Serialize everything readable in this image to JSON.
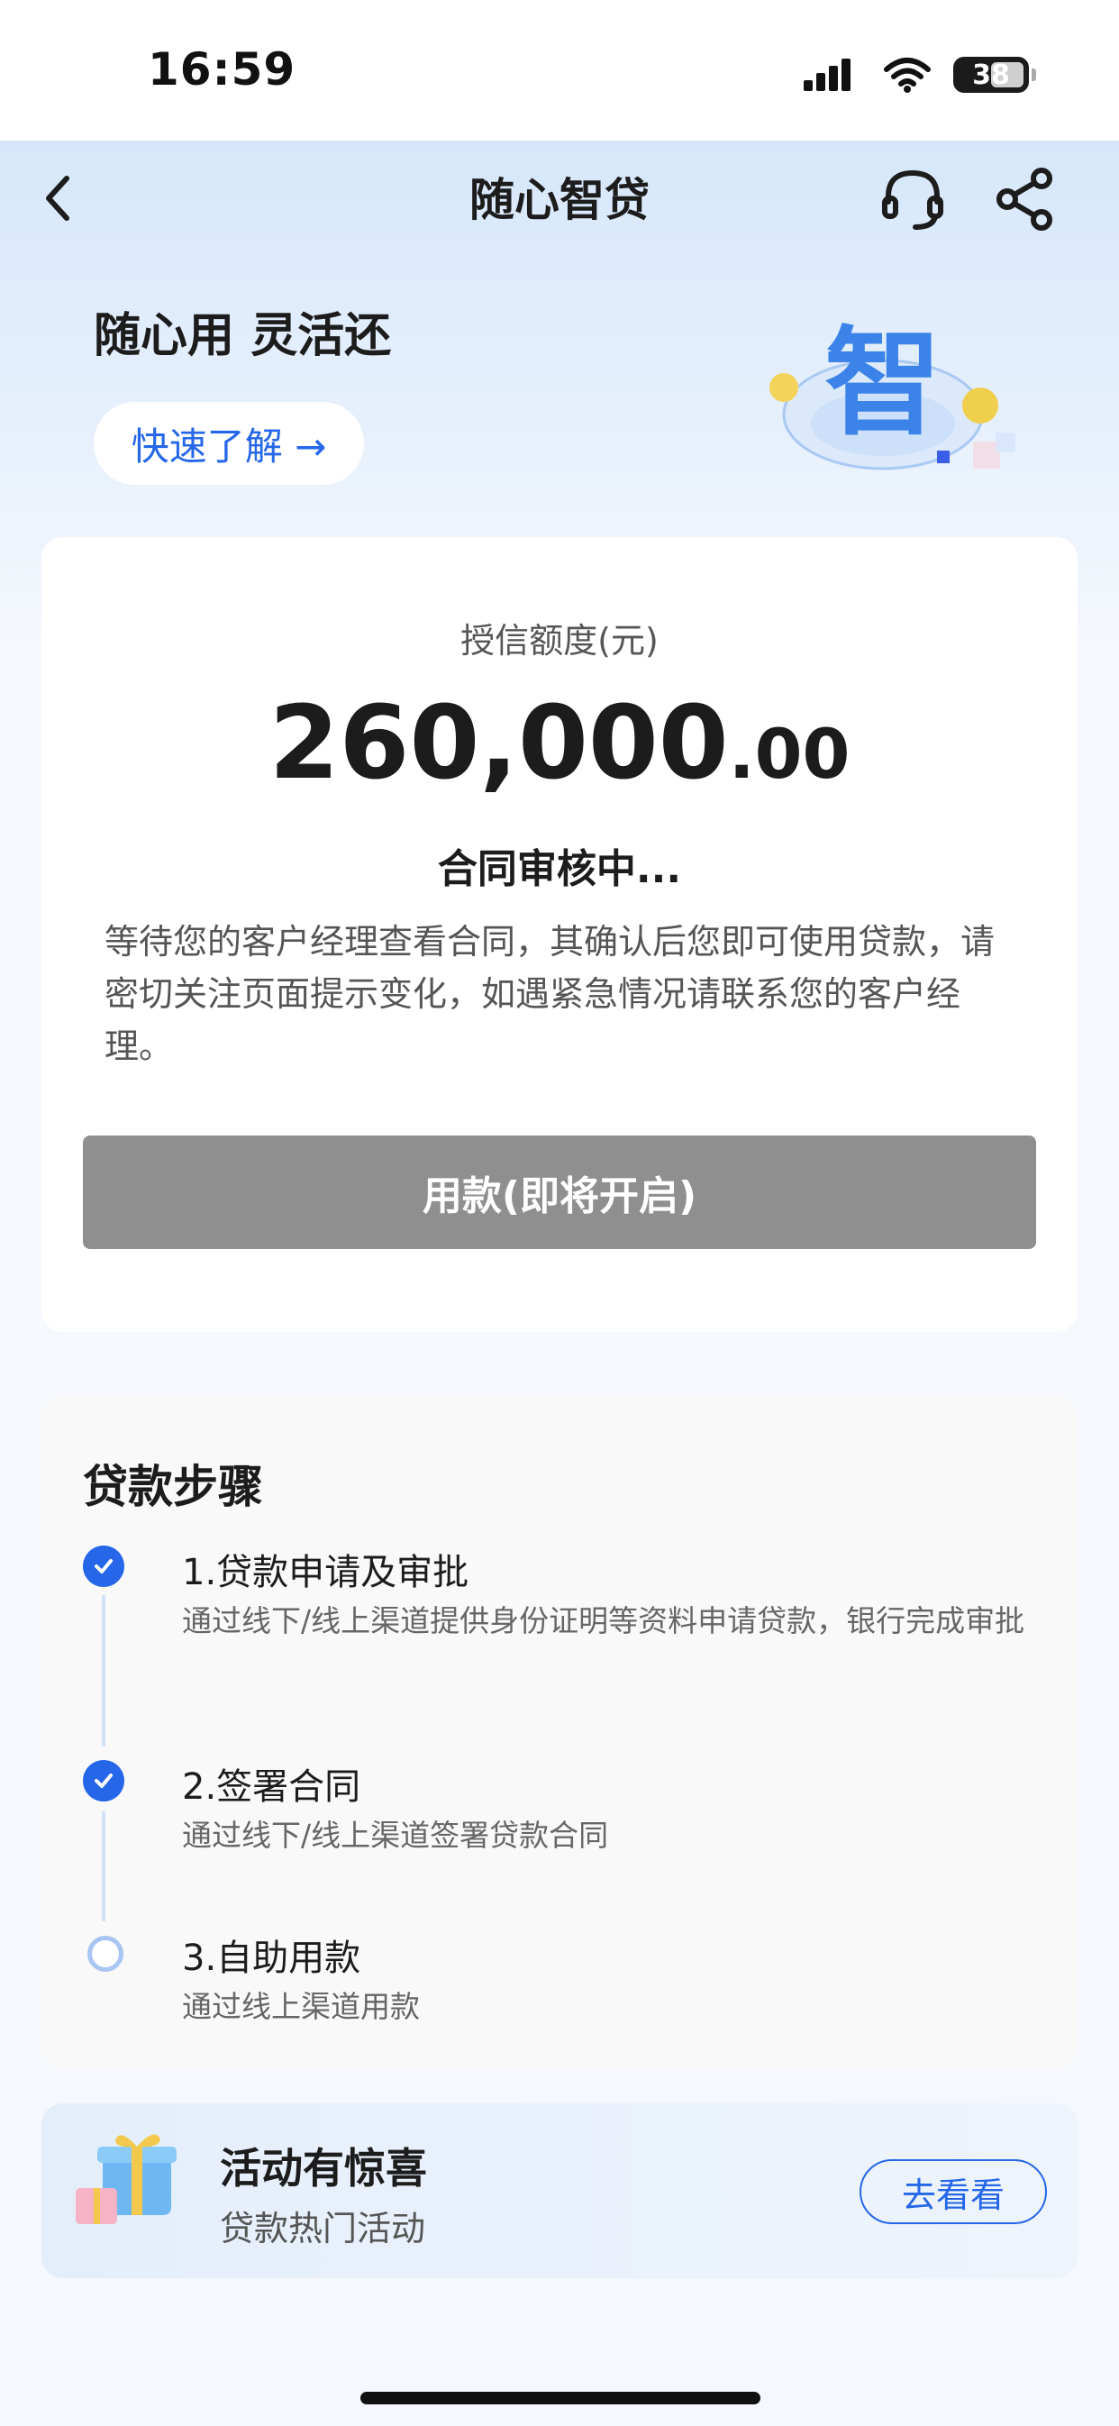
{
  "status_bar": {
    "time": "16:59",
    "battery": "38"
  },
  "nav": {
    "title": "随心智贷"
  },
  "hero": {
    "slogan": "随心用 灵活还",
    "quick_link": "快速了解 →",
    "illustration_glyph": "智"
  },
  "credit": {
    "label": "授信额度(元)",
    "amount_int": "260,000",
    "amount_dec": ".00",
    "status_title": "合同审核中...",
    "status_desc": "等待您的客户经理查看合同，其确认后您即可使用贷款，请密切关注页面提示变化，如遇紧急情况请联系您的客户经理。",
    "use_button": "用款(即将开启)"
  },
  "steps": {
    "title": "贷款步骤",
    "items": [
      {
        "title": "1.贷款申请及审批",
        "desc": "通过线下/线上渠道提供身份证明等资料申请贷款，银行完成审批",
        "done": true
      },
      {
        "title": "2.签署合同",
        "desc": "通过线下/线上渠道签署贷款合同",
        "done": true
      },
      {
        "title": "3.自助用款",
        "desc": "通过线上渠道用款",
        "done": false
      }
    ]
  },
  "promo": {
    "title": "活动有惊喜",
    "subtitle": "贷款热门活动",
    "button": "去看看"
  },
  "colors": {
    "accent": "#2567e8",
    "disabled_button": "#8f8f8f"
  },
  "icons": [
    "back-icon",
    "headset-icon",
    "share-icon",
    "check-icon",
    "gift-icon",
    "signal-icon",
    "wifi-icon",
    "battery-icon"
  ]
}
